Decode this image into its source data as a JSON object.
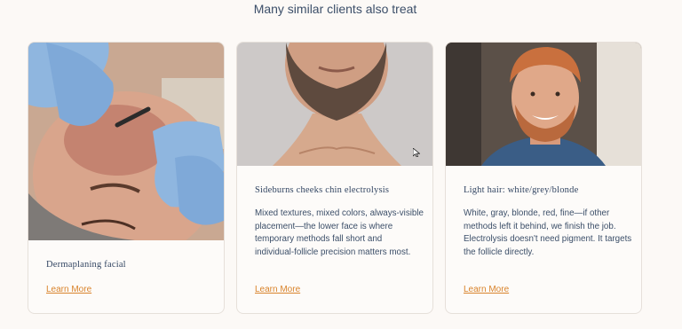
{
  "section": {
    "heading": "Many similar clients also treat"
  },
  "cards": [
    {
      "title": "Dermaplaning facial",
      "description": "",
      "link_label": "Learn More",
      "image": "dermaplaning-facial-photo"
    },
    {
      "title": "Sideburns cheeks chin electrolysis",
      "description": "Mixed textures, mixed colors, always-visible placement—the lower face is where temporary methods fall short and individual-follicle precision matters most.",
      "link_label": "Learn More",
      "image": "bearded-jaw-photo"
    },
    {
      "title": "Light hair: white/grey/blonde",
      "description": "White, gray, blonde, red, fine—if other methods left it behind, we finish the job. Electrolysis doesn't need pigment. It targets the follicle directly.",
      "link_label": "Learn More",
      "image": "red-haired-man-photo"
    }
  ],
  "colors": {
    "background": "#fcf9f6",
    "text": "#3c4f69",
    "link": "#d9832b",
    "border": "#e6e0da"
  }
}
